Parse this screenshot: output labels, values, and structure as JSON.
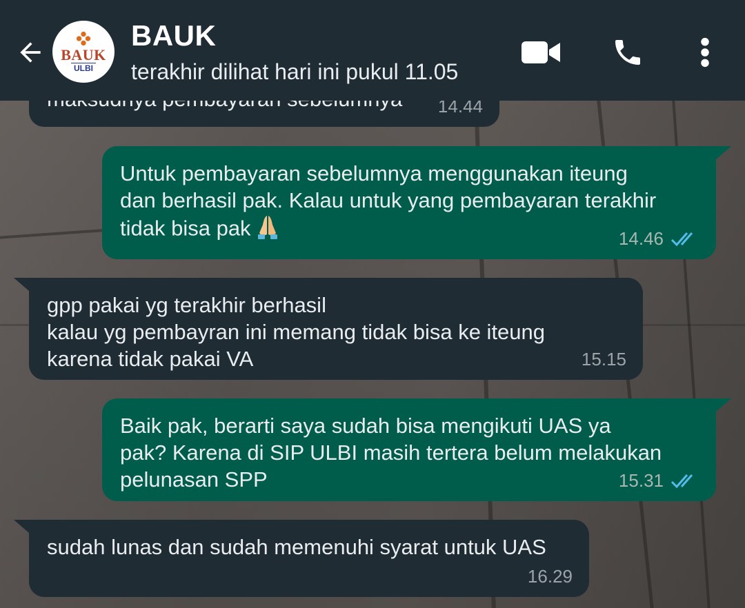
{
  "header": {
    "contact_name": "BAUK",
    "status": "terakhir dilihat hari ini pukul 11.05",
    "avatar": {
      "logo_top": "BAUK",
      "logo_bottom": "ULBI"
    }
  },
  "messages": [
    {
      "direction": "in",
      "text": "maksudnya pembayaran sebelumnya",
      "time": "14.44"
    },
    {
      "direction": "out",
      "text": "Untuk pembayaran sebelumnya menggunakan iteung\ndan berhasil pak. Kalau untuk yang pembayaran terakhir\ntidak bisa pak",
      "emoji": "folded-hands",
      "time": "14.46",
      "read": true
    },
    {
      "direction": "in",
      "text": "gpp pakai yg terakhir berhasil\nkalau yg pembayran ini memang tidak bisa ke iteung\nkarena tidak pakai VA",
      "time": "15.15"
    },
    {
      "direction": "out",
      "text": "Baik pak, berarti saya sudah bisa mengikuti UAS ya\npak? Karena di SIP ULBI masih tertera belum melakukan\npelunasan SPP",
      "time": "15.31",
      "read": true
    },
    {
      "direction": "in",
      "text": "sudah lunas dan sudah memenuhi syarat untuk UAS",
      "time": "16.29"
    }
  ],
  "icons": {
    "back": "arrow-left-icon",
    "video": "video-camera-icon",
    "call": "phone-icon",
    "menu": "more-vertical-icon",
    "read_receipt": "double-check-icon"
  },
  "colors": {
    "header_bg": "#1f2c34",
    "incoming_bubble": "#1f2c34",
    "outgoing_bubble": "#005c4b",
    "read_tick": "#53bdeb",
    "text": "#e9edef"
  }
}
